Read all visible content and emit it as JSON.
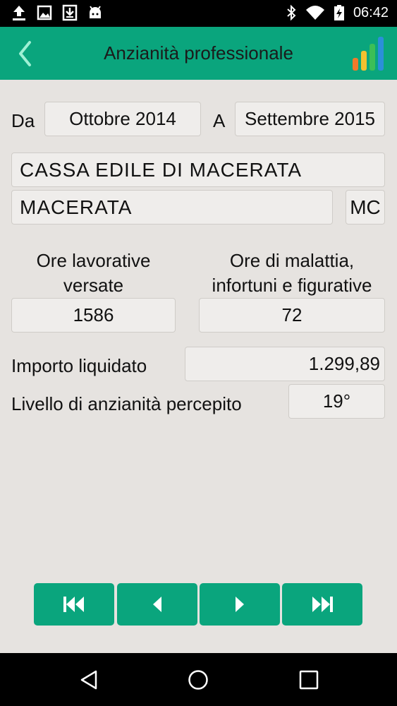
{
  "status": {
    "time": "06:42"
  },
  "header": {
    "title": "Anzianità professionale"
  },
  "period": {
    "from_label": "Da",
    "from_value": "Ottobre 2014",
    "to_label": "A",
    "to_value": "Settembre 2015"
  },
  "cassa": {
    "name": "CASSA EDILE DI MACERATA",
    "city": "MACERATA",
    "province": "MC"
  },
  "hours": {
    "worked_label_line1": "Ore lavorative",
    "worked_label_line2": "versate",
    "worked_value": "1586",
    "sick_label_line1": "Ore di malattia,",
    "sick_label_line2": "infortuni e figurative",
    "sick_value": "72"
  },
  "amount": {
    "label": "Importo liquidato",
    "value": "1.299,89"
  },
  "level": {
    "label": "Livello di anzianità percepito",
    "value": "19°"
  },
  "colors": {
    "accent": "#0aa57d",
    "background": "#e6e3e0",
    "field": "#efedeb"
  },
  "icons": [
    "upload-icon",
    "image-icon",
    "download-icon",
    "android-icon",
    "bluetooth-icon",
    "wifi-icon",
    "battery-icon",
    "back-arrow-icon",
    "chart-logo-icon",
    "first-icon",
    "previous-icon",
    "next-icon",
    "last-icon",
    "nav-back-icon",
    "nav-home-icon",
    "nav-recents-icon"
  ]
}
